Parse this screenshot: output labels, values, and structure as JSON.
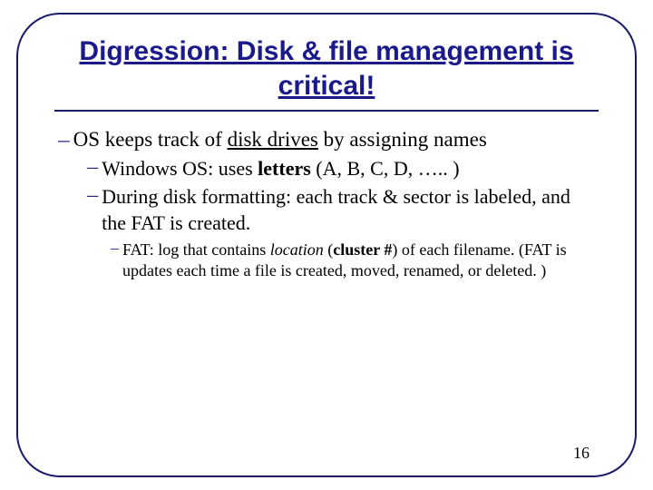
{
  "title": "Digression: Disk & file management is critical!",
  "bullets": {
    "l1": {
      "pre": "OS keeps track of ",
      "u": "disk drives",
      "post": " by assigning names"
    },
    "l2a": {
      "pre": "Windows OS:  uses ",
      "b": "letters",
      "post": "  (A, B, C, D, ….. )"
    },
    "l2b": "During disk formatting:  each track & sector is labeled, and the FAT is created.",
    "l3": {
      "pre": "FAT:  log that contains ",
      "i": "location",
      "post1": " (",
      "b": "cluster #",
      "post2": ") of each filename. (FAT is updates each time a file is created, moved, renamed, or deleted. )"
    }
  },
  "page_number": "16"
}
